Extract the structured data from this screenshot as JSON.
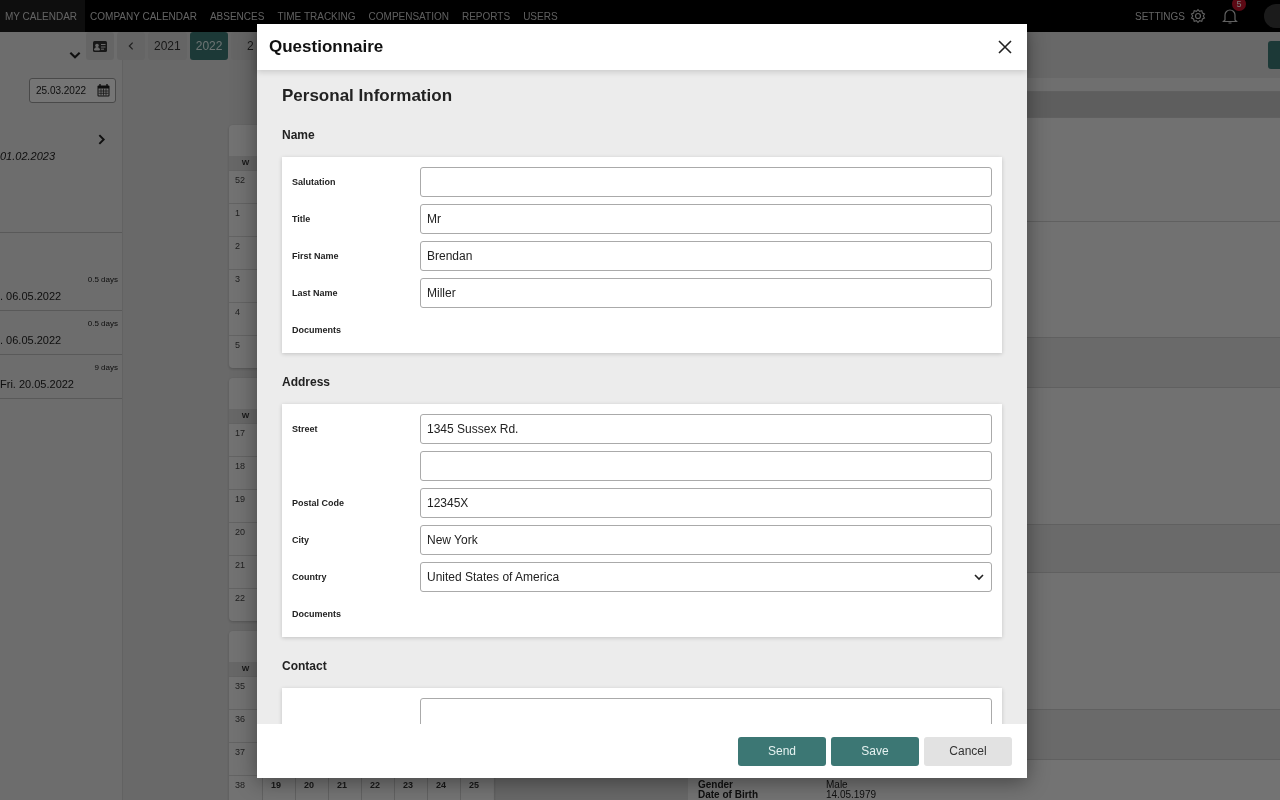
{
  "nav": {
    "items": [
      {
        "label": "MY CALENDAR",
        "selected": true
      },
      {
        "label": "COMPANY CALENDAR",
        "selected": false
      },
      {
        "label": "ABSENCES",
        "selected": false
      },
      {
        "label": "TIME TRACKING",
        "selected": false
      },
      {
        "label": "COMPENSATION",
        "selected": false
      },
      {
        "label": "REPORTS",
        "selected": false
      },
      {
        "label": "USERS",
        "selected": false
      }
    ],
    "settings": "SETTINGS",
    "notifications": "5"
  },
  "toolbar": {
    "years": [
      {
        "label": "2021",
        "selected": false
      },
      {
        "label": "2022",
        "selected": true
      },
      {
        "label": "2",
        "selected": false
      }
    ],
    "date": "25.03.2022"
  },
  "sidebar": {
    "period": "01.02.2023",
    "entries": [
      {
        "duration": "0.5 days",
        "date": ". 06.05.2022"
      },
      {
        "duration": "0.5 days",
        "date": ". 06.05.2022"
      },
      {
        "duration": "9 days",
        "date": "Fri. 20.05.2022"
      }
    ]
  },
  "calendar": {
    "months": [
      {
        "header": "W",
        "weeks": [
          {
            "week": "52"
          },
          {
            "week": "1"
          },
          {
            "week": "2"
          },
          {
            "week": "3"
          },
          {
            "week": "4"
          },
          {
            "week": "5"
          }
        ]
      },
      {
        "header": "W",
        "weeks": [
          {
            "week": "17"
          },
          {
            "week": "18"
          },
          {
            "week": "19"
          },
          {
            "week": "20"
          },
          {
            "week": "21"
          },
          {
            "week": "22"
          }
        ]
      },
      {
        "header": "W",
        "weeks": [
          {
            "week": "35"
          },
          {
            "week": "36"
          },
          {
            "week": "37"
          },
          {
            "week": "38",
            "days": [
              "19",
              "20",
              "21",
              "22",
              "23",
              "24",
              "25"
            ]
          }
        ]
      }
    ]
  },
  "details": {
    "rows": [
      {
        "label": "Gender",
        "value": "Male"
      },
      {
        "label": "Date of Birth",
        "value": "14.05.1979"
      }
    ]
  },
  "dialog": {
    "title": "Questionnaire",
    "heading": "Personal Information",
    "sections": [
      {
        "title": "Name",
        "fields": [
          {
            "kind": "text",
            "label": "Salutation"
          },
          {
            "kind": "text",
            "label": "Title",
            "value": "Mr"
          },
          {
            "kind": "text",
            "label": "First Name",
            "value": "Brendan"
          },
          {
            "kind": "text",
            "label": "Last Name",
            "value": "Miller"
          },
          {
            "kind": "documents",
            "label": "Documents"
          }
        ]
      },
      {
        "title": "Address",
        "fields": [
          {
            "kind": "text",
            "label": "Street",
            "value": "1345 Sussex Rd."
          },
          {
            "kind": "text"
          },
          {
            "kind": "text",
            "label": "Postal Code",
            "value": "12345X"
          },
          {
            "kind": "text",
            "label": "City",
            "value": "New York"
          },
          {
            "kind": "select",
            "label": "Country",
            "value": "United States of America"
          },
          {
            "kind": "documents",
            "label": "Documents"
          }
        ]
      },
      {
        "title": "Contact",
        "fields": [
          {
            "kind": "text"
          }
        ]
      }
    ],
    "buttons": [
      {
        "label": "Send",
        "kind": "primary"
      },
      {
        "label": "Save",
        "kind": "primary"
      },
      {
        "label": "Cancel",
        "kind": "secondary"
      }
    ]
  }
}
